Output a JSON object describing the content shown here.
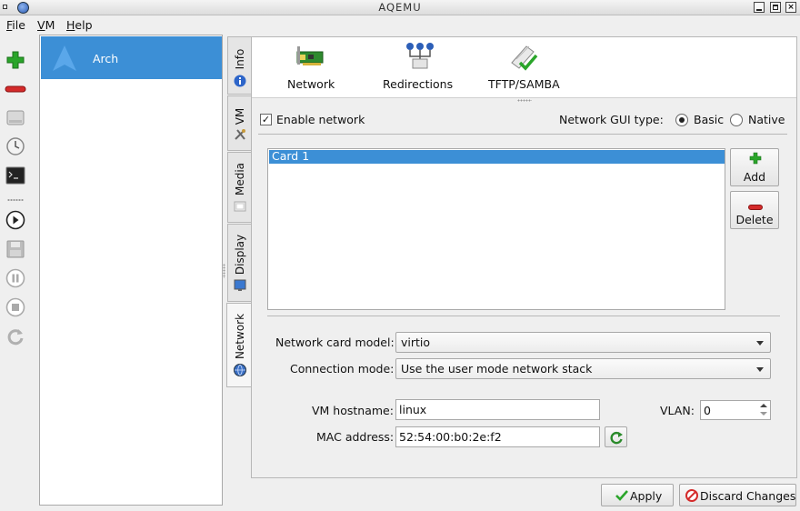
{
  "window": {
    "title": "AQEMU"
  },
  "menu": [
    {
      "label": "File",
      "mnemonic": "F",
      "rest": "ile"
    },
    {
      "label": "VM",
      "mnemonic": "V",
      "rest": "M"
    },
    {
      "label": "Help",
      "mnemonic": "H",
      "rest": "elp"
    }
  ],
  "toolbar": {
    "icons": [
      "add-vm-icon",
      "delete-vm-icon",
      "hdd-icon",
      "clock-icon",
      "terminal-icon",
      "play-icon",
      "save-icon",
      "pause-icon",
      "stop-icon",
      "reset-icon"
    ]
  },
  "vm_list": {
    "items": [
      {
        "label": "Arch"
      }
    ]
  },
  "side_tabs": [
    {
      "label": "Info"
    },
    {
      "label": "VM"
    },
    {
      "label": "Media"
    },
    {
      "label": "Display"
    },
    {
      "label": "Network"
    }
  ],
  "network_tabs": [
    {
      "label": "Network"
    },
    {
      "label": "Redirections"
    },
    {
      "label": "TFTP/SAMBA"
    }
  ],
  "network": {
    "enable_label": "Enable network",
    "enabled": true,
    "gui_type_label": "Network GUI type:",
    "gui_basic": "Basic",
    "gui_native": "Native",
    "gui_selected": "Basic",
    "cards": [
      {
        "label": "Card 1"
      }
    ],
    "add_label": "Add",
    "delete_label": "Delete",
    "model_label": "Network card model:",
    "model_value": "virtio",
    "mode_label": "Connection mode:",
    "mode_value": "Use the user mode network stack",
    "hostname_label": "VM hostname:",
    "hostname_value": "linux",
    "vlan_label": "VLAN:",
    "vlan_value": "0",
    "mac_label": "MAC address:",
    "mac_value": "52:54:00:b0:2e:f2"
  },
  "footer": {
    "apply_label": "Apply",
    "discard_label": "Discard Changes"
  },
  "colors": {
    "selection": "#3c8fd6",
    "add_green": "#2aa52a",
    "delete_red": "#d42a2a"
  }
}
